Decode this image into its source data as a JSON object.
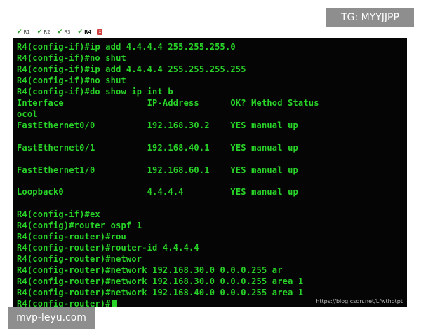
{
  "tabs": [
    {
      "label": "R1",
      "active": false
    },
    {
      "label": "R2",
      "active": false
    },
    {
      "label": "R3",
      "active": false
    },
    {
      "label": "R4",
      "active": true
    }
  ],
  "tab_close_label": "x",
  "terminal": {
    "lines": [
      "R4(config-if)#ip add 4.4.4.4 255.255.255.0",
      "R4(config-if)#no shut",
      "R4(config-if)#ip add 4.4.4.4 255.255.255.255",
      "R4(config-if)#no shut",
      "R4(config-if)#do show ip int b",
      "Interface                IP-Address      OK? Method Status",
      "ocol",
      "FastEthernet0/0          192.168.30.2    YES manual up",
      "",
      "FastEthernet0/1          192.168.40.1    YES manual up",
      "",
      "FastEthernet1/0          192.168.60.1    YES manual up",
      "",
      "Loopback0                4.4.4.4         YES manual up",
      "",
      "R4(config-if)#ex",
      "R4(config)#router ospf 1",
      "R4(config-router)#rou",
      "R4(config-router)#router-id 4.4.4.4",
      "R4(config-router)#networ",
      "R4(config-router)#network 192.168.30.0 0.0.0.255 ar",
      "R4(config-router)#network 192.168.30.0 0.0.0.255 area 1",
      "R4(config-router)#network 192.168.40.0 0.0.0.255 area 1",
      "R4(config-router)#"
    ],
    "source_credit": "https://blog.csdn.net/Lfwthotpt"
  },
  "overlays": {
    "tg": "TG: MYYJJPP",
    "site": "mvp-leyu.com"
  },
  "colors": {
    "terminal_bg": "#050505",
    "terminal_text": "#28d428",
    "overlay_bg": "#8e8e8e"
  }
}
